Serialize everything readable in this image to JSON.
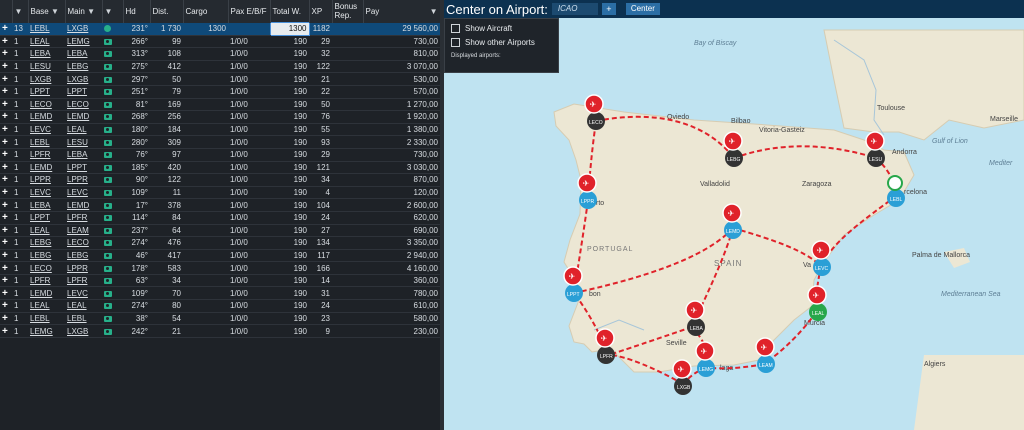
{
  "table": {
    "headers": {
      "base": "Base",
      "main": "Main",
      "hd": "Hd",
      "dist": "Dist.",
      "cargo": "Cargo",
      "pax": "Pax E/B/F",
      "totw": "Total W.",
      "xp": "XP",
      "bonus": "Bonus Rep.",
      "pay": "Pay"
    },
    "rows": [
      {
        "n": "13",
        "base": "LEBL",
        "main": "LXGB",
        "hd": "231°",
        "dist": "1 730",
        "cargo": "1300",
        "pax": "",
        "totw": "1300",
        "xp": "1182",
        "pay": "29 560,00"
      },
      {
        "n": "1",
        "base": "LEAL",
        "main": "LEMG",
        "hd": "266°",
        "dist": "99",
        "cargo": "",
        "pax": "1/0/0",
        "totw": "190",
        "xp": "29",
        "pay": "730,00"
      },
      {
        "n": "1",
        "base": "LEBA",
        "main": "LEBA",
        "hd": "313°",
        "dist": "108",
        "cargo": "",
        "pax": "1/0/0",
        "totw": "190",
        "xp": "32",
        "pay": "810,00"
      },
      {
        "n": "1",
        "base": "LESU",
        "main": "LEBG",
        "hd": "275°",
        "dist": "412",
        "cargo": "",
        "pax": "1/0/0",
        "totw": "190",
        "xp": "122",
        "pay": "3 070,00"
      },
      {
        "n": "1",
        "base": "LXGB",
        "main": "LXGB",
        "hd": "297°",
        "dist": "50",
        "cargo": "",
        "pax": "1/0/0",
        "totw": "190",
        "xp": "21",
        "pay": "530,00"
      },
      {
        "n": "1",
        "base": "LPPT",
        "main": "LPPT",
        "hd": "251°",
        "dist": "79",
        "cargo": "",
        "pax": "1/0/0",
        "totw": "190",
        "xp": "22",
        "pay": "570,00"
      },
      {
        "n": "1",
        "base": "LECO",
        "main": "LECO",
        "hd": "81°",
        "dist": "169",
        "cargo": "",
        "pax": "1/0/0",
        "totw": "190",
        "xp": "50",
        "pay": "1 270,00"
      },
      {
        "n": "1",
        "base": "LEMD",
        "main": "LEMD",
        "hd": "268°",
        "dist": "256",
        "cargo": "",
        "pax": "1/0/0",
        "totw": "190",
        "xp": "76",
        "pay": "1 920,00"
      },
      {
        "n": "1",
        "base": "LEVC",
        "main": "LEAL",
        "hd": "180°",
        "dist": "184",
        "cargo": "",
        "pax": "1/0/0",
        "totw": "190",
        "xp": "55",
        "pay": "1 380,00"
      },
      {
        "n": "1",
        "base": "LEBL",
        "main": "LESU",
        "hd": "280°",
        "dist": "309",
        "cargo": "",
        "pax": "1/0/0",
        "totw": "190",
        "xp": "93",
        "pay": "2 330,00"
      },
      {
        "n": "1",
        "base": "LPFR",
        "main": "LEBA",
        "hd": "76°",
        "dist": "97",
        "cargo": "",
        "pax": "1/0/0",
        "totw": "190",
        "xp": "29",
        "pay": "730,00"
      },
      {
        "n": "1",
        "base": "LEMD",
        "main": "LPPT",
        "hd": "185°",
        "dist": "420",
        "cargo": "",
        "pax": "1/0/0",
        "totw": "190",
        "xp": "121",
        "pay": "3 030,00"
      },
      {
        "n": "1",
        "base": "LPPR",
        "main": "LPPR",
        "hd": "90°",
        "dist": "122",
        "cargo": "",
        "pax": "1/0/0",
        "totw": "190",
        "xp": "34",
        "pay": "870,00"
      },
      {
        "n": "1",
        "base": "LEVC",
        "main": "LEVC",
        "hd": "109°",
        "dist": "11",
        "cargo": "",
        "pax": "1/0/0",
        "totw": "190",
        "xp": "4",
        "pay": "120,00"
      },
      {
        "n": "1",
        "base": "LEBA",
        "main": "LEMD",
        "hd": "17°",
        "dist": "378",
        "cargo": "",
        "pax": "1/0/0",
        "totw": "190",
        "xp": "104",
        "pay": "2 600,00"
      },
      {
        "n": "1",
        "base": "LPPT",
        "main": "LPFR",
        "hd": "114°",
        "dist": "84",
        "cargo": "",
        "pax": "1/0/0",
        "totw": "190",
        "xp": "24",
        "pay": "620,00"
      },
      {
        "n": "1",
        "base": "LEAL",
        "main": "LEAM",
        "hd": "237°",
        "dist": "64",
        "cargo": "",
        "pax": "1/0/0",
        "totw": "190",
        "xp": "27",
        "pay": "690,00"
      },
      {
        "n": "1",
        "base": "LEBG",
        "main": "LECO",
        "hd": "274°",
        "dist": "476",
        "cargo": "",
        "pax": "1/0/0",
        "totw": "190",
        "xp": "134",
        "pay": "3 350,00"
      },
      {
        "n": "1",
        "base": "LEBG",
        "main": "LEBG",
        "hd": "46°",
        "dist": "417",
        "cargo": "",
        "pax": "1/0/0",
        "totw": "190",
        "xp": "117",
        "pay": "2 940,00"
      },
      {
        "n": "1",
        "base": "LECO",
        "main": "LPPR",
        "hd": "178°",
        "dist": "583",
        "cargo": "",
        "pax": "1/0/0",
        "totw": "190",
        "xp": "166",
        "pay": "4 160,00"
      },
      {
        "n": "1",
        "base": "LPFR",
        "main": "LPFR",
        "hd": "63°",
        "dist": "34",
        "cargo": "",
        "pax": "1/0/0",
        "totw": "190",
        "xp": "14",
        "pay": "360,00"
      },
      {
        "n": "1",
        "base": "LEMD",
        "main": "LEVC",
        "hd": "109°",
        "dist": "70",
        "cargo": "",
        "pax": "1/0/0",
        "totw": "190",
        "xp": "31",
        "pay": "780,00"
      },
      {
        "n": "1",
        "base": "LEAL",
        "main": "LEAL",
        "hd": "274°",
        "dist": "80",
        "cargo": "",
        "pax": "1/0/0",
        "totw": "190",
        "xp": "24",
        "pay": "610,00"
      },
      {
        "n": "1",
        "base": "LEBL",
        "main": "LEBL",
        "hd": "38°",
        "dist": "54",
        "cargo": "",
        "pax": "1/0/0",
        "totw": "190",
        "xp": "23",
        "pay": "580,00"
      },
      {
        "n": "1",
        "base": "LEMG",
        "main": "LXGB",
        "hd": "242°",
        "dist": "21",
        "cargo": "",
        "pax": "1/0/0",
        "totw": "190",
        "xp": "9",
        "pay": "230,00"
      }
    ]
  },
  "map": {
    "title": "Center on Airport:",
    "icao_placeholder": "ICAO",
    "plus_label": "+",
    "center_label": "Center",
    "show_aircraft": "Show Aircraft",
    "show_other": "Show other Airports",
    "displayed": "Displayed airports:",
    "labels": {
      "bay": "Bay of Biscay",
      "oviedo": "Oviedo",
      "bilbao": "Bilbao",
      "vitoria": "Vitoria-Gasteiz",
      "toulouse": "Toulouse",
      "marseille": "Marseille",
      "andorra": "Andorra",
      "gulf": "Gulf of Lion",
      "medit": "Mediter",
      "valladolid": "Valladolid",
      "zaragoza": "Zaragoza",
      "barcelona": "rcelona",
      "porto": "rto",
      "portugal": "PORTUGAL",
      "spain": "SPAIN",
      "palma": "Palma de Mallorca",
      "lisbon": "bon",
      "medsea": "Mediterranean Sea",
      "murcia": "Murcia",
      "seville": "Seville",
      "malaga": "laga",
      "algiers": "Algiers",
      "madrid": "rid",
      "valencia": "Va"
    },
    "airports": {
      "leco": "LECO",
      "lebg": "LEBG",
      "lesu": "LESU",
      "lebl": "LEBL",
      "lppr": "LPPR",
      "lemd": "LEMD",
      "lppt": "LPPT",
      "levc": "LEVC",
      "leal": "LEAL",
      "leba": "LEBA",
      "lpfr": "LPFR",
      "lemg": "LEMG",
      "lxgb": "LXGB",
      "leam": "LEAM"
    },
    "colors": {
      "route": "#e0222a",
      "water": "#bfe3f1",
      "land": "#ece7d4"
    }
  }
}
